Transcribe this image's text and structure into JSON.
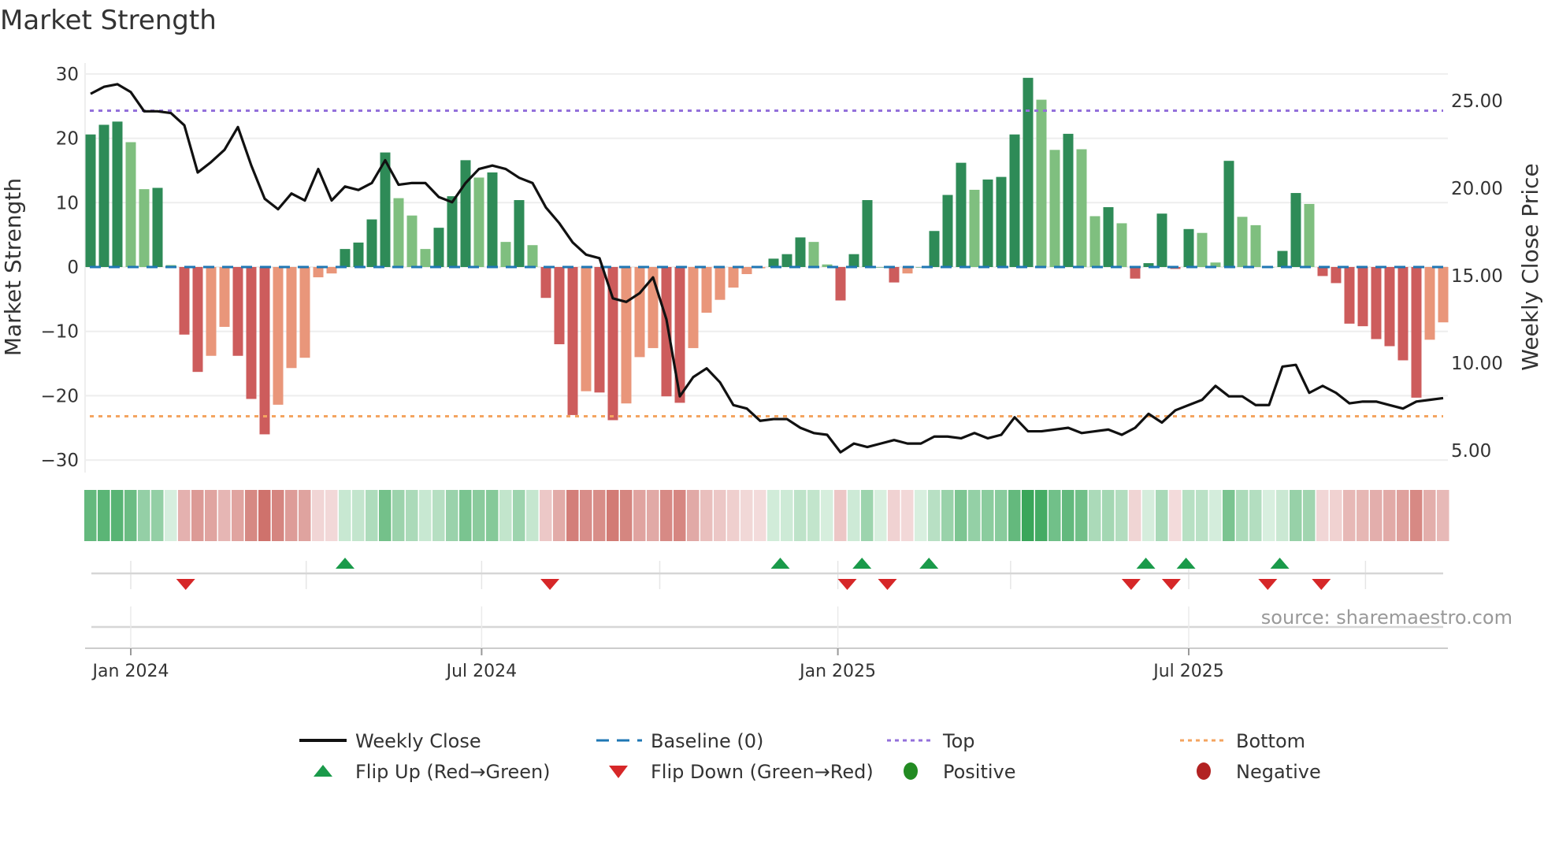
{
  "title": "Market Strength",
  "source": "source: sharemaestro.com",
  "colors": {
    "pos_dark": "#2e8b57",
    "pos_light": "#7fbf7f",
    "neg_dark": "#cd5c5c",
    "neg_light": "#e9967a",
    "line": "#111111",
    "baseline": "#1f77b4",
    "top": "#9370db",
    "bottom": "#f4a460",
    "flip_up": "#1a9a4a",
    "flip_down": "#d62728",
    "positive": "#228b22",
    "negative": "#b22222"
  },
  "chart_data": {
    "type": "bar",
    "title": "Market Strength",
    "ylabel": "Market Strength",
    "y2label": "Weekly Close Price",
    "ylim": [
      -31.5,
      31.5
    ],
    "y2lim": [
      4.2,
      27.6
    ],
    "yticks": [
      "30",
      "20",
      "10",
      "0",
      "−10",
      "−20",
      "−30"
    ],
    "ytick_values": [
      30,
      20,
      10,
      0,
      -10,
      -20,
      -30
    ],
    "y2ticks": [
      "25.00",
      "20.00",
      "15.00",
      "10.00",
      "5.00"
    ],
    "y2tick_values": [
      25,
      20,
      15,
      10,
      5
    ],
    "top_level": 24.3,
    "bottom_level": -23.2,
    "baseline": 0,
    "xticks": [
      {
        "label": "Jan 2024",
        "index": 3
      },
      {
        "label": "Jul 2024",
        "index": 29.2
      },
      {
        "label": "Jan 2025",
        "index": 55.8
      },
      {
        "label": "Jul 2025",
        "index": 82
      }
    ],
    "minor_xticks": [
      3,
      16.1,
      29.2,
      42.5,
      55.8,
      68.7,
      82,
      95.2
    ],
    "strength": [
      20.6,
      22.1,
      22.6,
      19.4,
      12.1,
      12.3,
      0.3,
      -10.5,
      -16.3,
      -13.8,
      -9.3,
      -13.8,
      -20.5,
      -26,
      -21.4,
      -15.7,
      -14.1,
      -1.6,
      -1,
      2.8,
      3.8,
      7.4,
      17.8,
      10.7,
      8,
      2.8,
      6.1,
      11,
      16.6,
      13.9,
      14.7,
      3.9,
      10.4,
      3.4,
      -4.8,
      -12,
      -23,
      -19.3,
      -19.5,
      -23.8,
      -21.2,
      -14,
      -12.6,
      -20.1,
      -21.1,
      -12.6,
      -7.1,
      -5.1,
      -3.2,
      -1.1,
      -0.2,
      1.3,
      2,
      4.6,
      3.9,
      0.4,
      -5.2,
      2,
      10.4,
      0,
      -2.4,
      -1,
      0,
      5.6,
      11.2,
      16.2,
      12,
      13.6,
      14,
      20.6,
      29.4,
      26,
      18.2,
      20.7,
      18.3,
      7.9,
      9.3,
      6.8,
      -1.8,
      0.6,
      8.3,
      -0.3,
      5.9,
      5.3,
      0.7,
      16.5,
      7.8,
      6.5,
      0,
      2.5,
      11.5,
      9.8,
      -1.4,
      -2.5,
      -8.8,
      -9.2,
      -11.2,
      -12.3,
      -14.5,
      -20.3,
      -11.3,
      -8.6
    ],
    "shade": [
      "d",
      "d",
      "d",
      "l",
      "l",
      "d",
      "l",
      "d",
      "d",
      "l",
      "l",
      "d",
      "d",
      "d",
      "l",
      "l",
      "l",
      "l",
      "l",
      "d",
      "d",
      "d",
      "d",
      "l",
      "l",
      "l",
      "d",
      "d",
      "d",
      "l",
      "d",
      "l",
      "d",
      "l",
      "d",
      "d",
      "d",
      "l",
      "d",
      "d",
      "l",
      "l",
      "l",
      "d",
      "d",
      "l",
      "l",
      "l",
      "l",
      "l",
      "l",
      "d",
      "d",
      "d",
      "l",
      "l",
      "d",
      "d",
      "d",
      "d",
      "d",
      "l",
      "d",
      "d",
      "d",
      "d",
      "l",
      "d",
      "d",
      "d",
      "d",
      "l",
      "l",
      "d",
      "l",
      "l",
      "d",
      "l",
      "d",
      "d",
      "d",
      "d",
      "d",
      "l",
      "l",
      "d",
      "l",
      "l",
      "d",
      "d",
      "d",
      "l",
      "d",
      "d",
      "d",
      "d",
      "d",
      "d",
      "d",
      "d",
      "l",
      "l"
    ],
    "weekly_close": [
      25.4,
      25.8,
      25.95,
      25.5,
      24.4,
      24.4,
      24.3,
      23.6,
      20.9,
      21.5,
      22.2,
      23.5,
      21.3,
      19.4,
      18.8,
      19.7,
      19.3,
      21.1,
      19.3,
      20.1,
      19.9,
      20.3,
      21.6,
      20.2,
      20.3,
      20.3,
      19.5,
      19.2,
      20.3,
      21.1,
      21.3,
      21.1,
      20.6,
      20.3,
      18.9,
      18,
      16.9,
      16.2,
      16,
      13.7,
      13.5,
      14,
      14.9,
      12.5,
      8.1,
      9.2,
      9.7,
      8.9,
      7.6,
      7.4,
      6.7,
      6.8,
      6.8,
      6.3,
      6,
      5.9,
      4.9,
      5.4,
      5.2,
      5.4,
      5.6,
      5.4,
      5.4,
      5.8,
      5.8,
      5.7,
      6,
      5.7,
      5.9,
      6.9,
      6.1,
      6.1,
      6.2,
      6.3,
      6,
      6.1,
      6.2,
      5.9,
      6.3,
      7.1,
      6.6,
      7.3,
      7.6,
      7.9,
      8.7,
      8.1,
      8.1,
      7.6,
      7.6,
      9.8,
      9.9,
      8.3,
      8.7,
      8.3,
      7.7,
      7.8,
      7.8,
      7.6,
      7.4,
      7.8,
      7.9,
      8.0
    ],
    "flip_up": [
      19,
      51.5,
      57.6,
      62.6,
      78.8,
      81.8,
      88.8
    ],
    "flip_down": [
      7.1,
      34.3,
      56.5,
      59.5,
      77.7,
      80.7,
      87.9,
      91.9
    ]
  },
  "legend": [
    {
      "label": "Weekly Close",
      "key": "line"
    },
    {
      "label": "Baseline (0)",
      "key": "baseline"
    },
    {
      "label": "Top",
      "key": "top"
    },
    {
      "label": "Bottom",
      "key": "bottom"
    },
    {
      "label": "Flip Up (Red→Green)",
      "key": "flip_up"
    },
    {
      "label": "Flip Down (Green→Red)",
      "key": "flip_down"
    },
    {
      "label": "Positive",
      "key": "positive"
    },
    {
      "label": "Negative",
      "key": "negative"
    }
  ]
}
